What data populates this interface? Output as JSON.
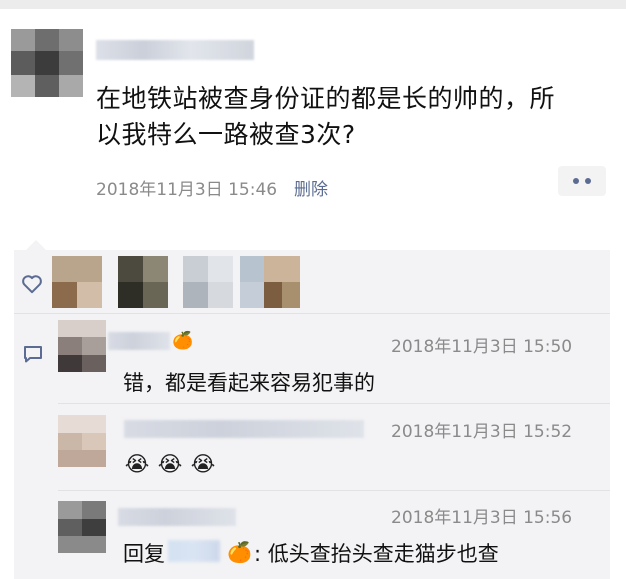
{
  "post": {
    "text_line1": "在地铁站被查身份证的都是长的帅的，所",
    "text_line2": "以我特么一路被查3次?",
    "time": "2018年11月3日 15:46",
    "delete_label": "删除",
    "more_icon": "ellipsis-icon"
  },
  "likes": {
    "icon": "heart-icon",
    "avatar_count": 5
  },
  "comments": [
    {
      "time": "2018年11月3日 15:50",
      "text": "错，都是看起来容易犯事的",
      "emoji": "🍊"
    },
    {
      "time": "2018年11月3日 15:52",
      "emojis": [
        "😭",
        "😭",
        "😭"
      ]
    },
    {
      "time": "2018年11月3日 15:56",
      "reply_prefix": "回复",
      "reply_emoji": "🍊",
      "reply_text": ": 低头查抬头查走猫步也查"
    }
  ],
  "colors": {
    "link": "#5b6b92",
    "panel": "#f3f3f5",
    "time": "#8a8a8a"
  }
}
